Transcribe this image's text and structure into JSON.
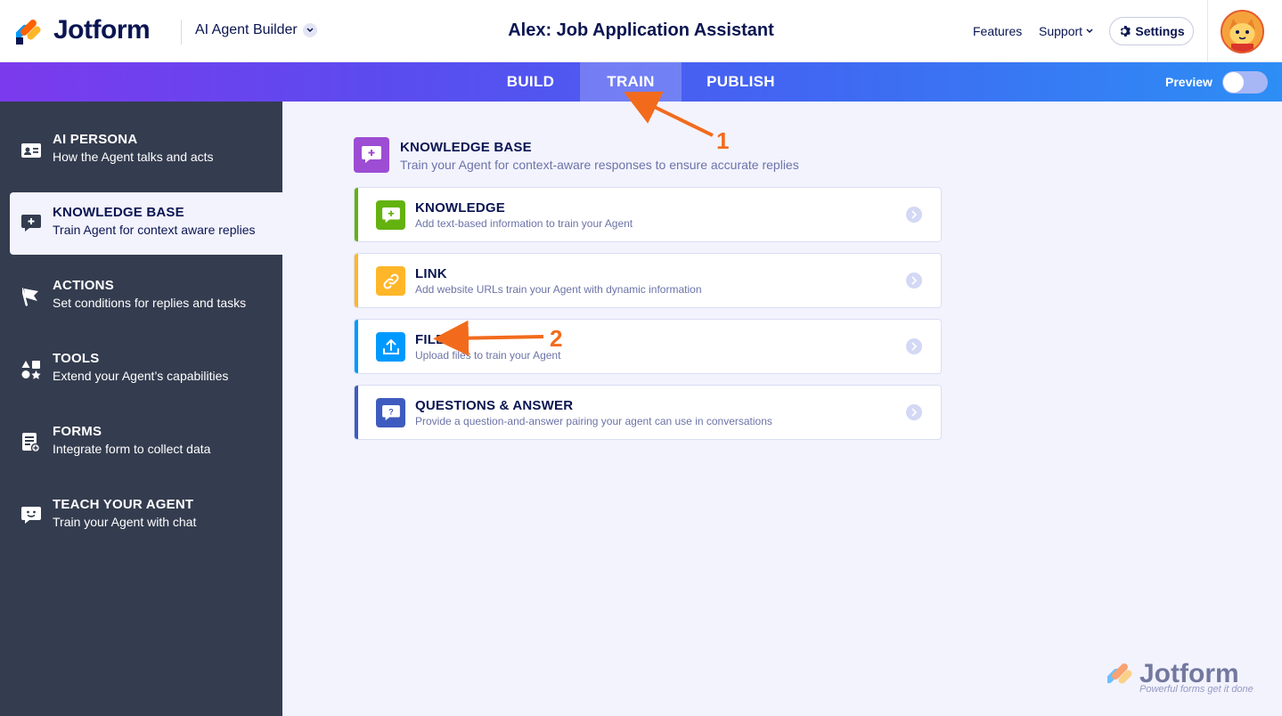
{
  "header": {
    "brand": "Jotform",
    "product": "AI Agent Builder",
    "agent_title": "Alex: Job Application Assistant",
    "features": "Features",
    "support": "Support",
    "settings": "Settings"
  },
  "tabs": [
    {
      "label": "BUILD",
      "active": false
    },
    {
      "label": "TRAIN",
      "active": true
    },
    {
      "label": "PUBLISH",
      "active": false
    }
  ],
  "preview": {
    "label": "Preview",
    "on": false
  },
  "sidebar": {
    "items": [
      {
        "title": "AI PERSONA",
        "sub": "How the Agent talks and acts",
        "icon": "id-card-icon"
      },
      {
        "title": "KNOWLEDGE BASE",
        "sub": "Train Agent for context aware replies",
        "icon": "chat-plus-icon",
        "active": true
      },
      {
        "title": "ACTIONS",
        "sub": "Set conditions for replies and tasks",
        "icon": "flag-icon"
      },
      {
        "title": "TOOLS",
        "sub": "Extend your Agent’s capabilities",
        "icon": "shapes-icon"
      },
      {
        "title": "FORMS",
        "sub": "Integrate form to collect data",
        "icon": "form-icon"
      },
      {
        "title": "TEACH YOUR AGENT",
        "sub": "Train your Agent with chat",
        "icon": "smile-chat-icon"
      }
    ]
  },
  "main": {
    "title": "KNOWLEDGE BASE",
    "subtitle": "Train your Agent for context-aware responses to ensure accurate replies",
    "cards": [
      {
        "title": "KNOWLEDGE",
        "sub": "Add text-based information to train your Agent",
        "color": "#64b20f",
        "icon": "chat-plus-icon"
      },
      {
        "title": "LINK",
        "sub": "Add website URLs train your Agent with dynamic information",
        "color": "#ffb629",
        "icon": "link-icon"
      },
      {
        "title": "FILE",
        "sub": "Upload files to train your Agent",
        "color": "#0099ff",
        "icon": "upload-icon"
      },
      {
        "title": "QUESTIONS & ANSWER",
        "sub": "Provide a question-and-answer pairing your agent can use in conversations",
        "color": "#3e5bbf",
        "icon": "question-chat-icon"
      }
    ]
  },
  "annotations": {
    "one": "1",
    "two": "2"
  },
  "watermark": {
    "brand": "Jotform",
    "tagline": "Powerful forms get it done"
  }
}
